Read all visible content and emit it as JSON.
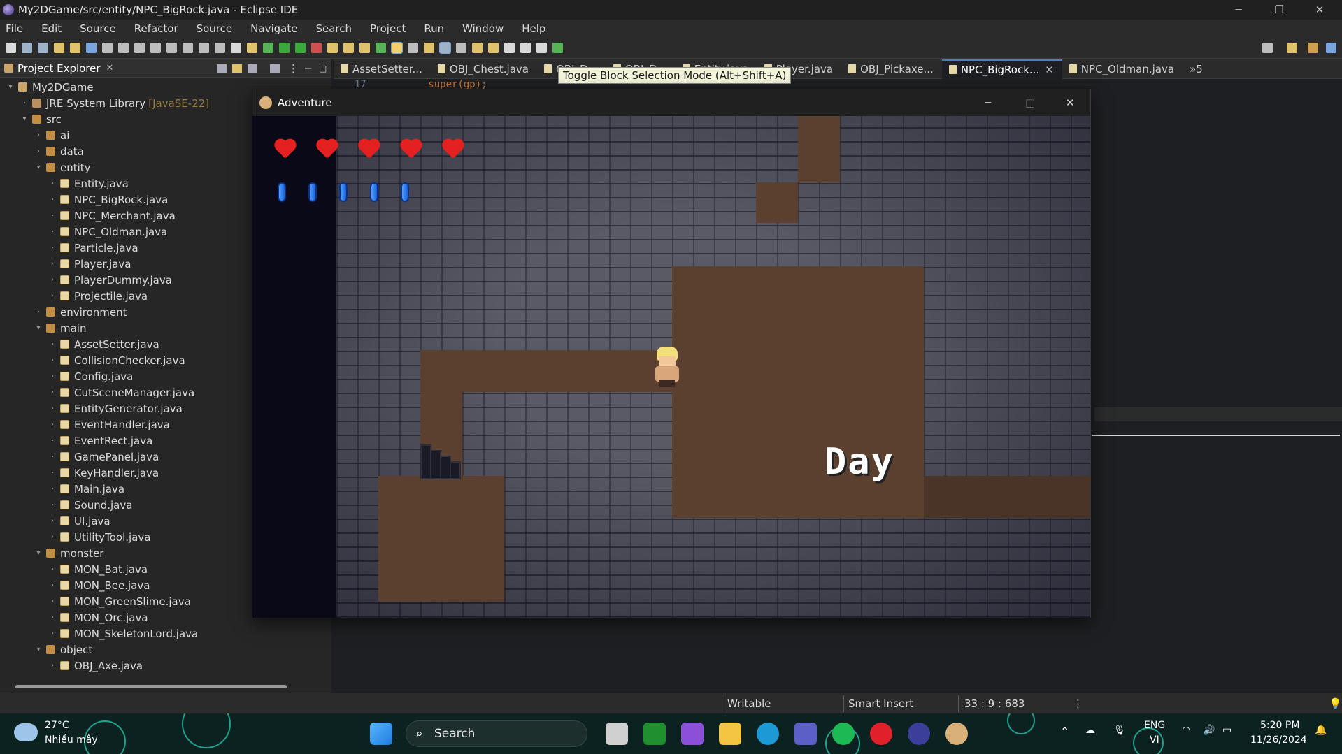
{
  "window": {
    "title": "My2DGame/src/entity/NPC_BigRock.java - Eclipse IDE"
  },
  "menu": [
    "File",
    "Edit",
    "Source",
    "Refactor",
    "Source",
    "Navigate",
    "Search",
    "Project",
    "Run",
    "Window",
    "Help"
  ],
  "sidebar": {
    "tab_label": "Project Explorer",
    "tree": [
      {
        "label": "My2DGame",
        "icon": "project-icon",
        "depth": 0,
        "expanded": true
      },
      {
        "label": "JRE System Library",
        "suffix": "[JavaSE-22]",
        "icon": "library-icon",
        "depth": 1,
        "expanded": false
      },
      {
        "label": "src",
        "icon": "package-folder-icon",
        "depth": 1,
        "expanded": true
      },
      {
        "label": "ai",
        "icon": "package-icon",
        "depth": 2,
        "expanded": false
      },
      {
        "label": "data",
        "icon": "package-icon",
        "depth": 2,
        "expanded": false
      },
      {
        "label": "entity",
        "icon": "package-icon",
        "depth": 2,
        "expanded": true
      },
      {
        "label": "Entity.java",
        "icon": "java-file-icon",
        "depth": 3
      },
      {
        "label": "NPC_BigRock.java",
        "icon": "java-file-icon",
        "depth": 3
      },
      {
        "label": "NPC_Merchant.java",
        "icon": "java-file-icon",
        "depth": 3
      },
      {
        "label": "NPC_Oldman.java",
        "icon": "java-file-icon",
        "depth": 3
      },
      {
        "label": "Particle.java",
        "icon": "java-file-icon",
        "depth": 3
      },
      {
        "label": "Player.java",
        "icon": "java-file-icon",
        "depth": 3
      },
      {
        "label": "PlayerDummy.java",
        "icon": "java-file-icon",
        "depth": 3
      },
      {
        "label": "Projectile.java",
        "icon": "java-file-icon",
        "depth": 3
      },
      {
        "label": "environment",
        "icon": "package-icon",
        "depth": 2,
        "expanded": false
      },
      {
        "label": "main",
        "icon": "package-icon",
        "depth": 2,
        "expanded": true
      },
      {
        "label": "AssetSetter.java",
        "icon": "java-file-icon",
        "depth": 3
      },
      {
        "label": "CollisionChecker.java",
        "icon": "java-file-icon",
        "depth": 3
      },
      {
        "label": "Config.java",
        "icon": "java-file-icon",
        "depth": 3
      },
      {
        "label": "CutSceneManager.java",
        "icon": "java-file-icon",
        "depth": 3
      },
      {
        "label": "EntityGenerator.java",
        "icon": "java-file-icon",
        "depth": 3
      },
      {
        "label": "EventHandler.java",
        "icon": "java-file-icon",
        "depth": 3
      },
      {
        "label": "EventRect.java",
        "icon": "java-file-icon",
        "depth": 3
      },
      {
        "label": "GamePanel.java",
        "icon": "java-file-icon",
        "depth": 3
      },
      {
        "label": "KeyHandler.java",
        "icon": "java-file-icon",
        "depth": 3
      },
      {
        "label": "Main.java",
        "icon": "java-file-icon",
        "depth": 3
      },
      {
        "label": "Sound.java",
        "icon": "java-file-icon",
        "depth": 3
      },
      {
        "label": "UI.java",
        "icon": "java-file-icon",
        "depth": 3
      },
      {
        "label": "UtilityTool.java",
        "icon": "java-file-icon",
        "depth": 3
      },
      {
        "label": "monster",
        "icon": "package-icon",
        "depth": 2,
        "expanded": true
      },
      {
        "label": "MON_Bat.java",
        "icon": "java-file-icon",
        "depth": 3
      },
      {
        "label": "MON_Bee.java",
        "icon": "java-file-icon",
        "depth": 3
      },
      {
        "label": "MON_GreenSlime.java",
        "icon": "java-file-icon",
        "depth": 3
      },
      {
        "label": "MON_Orc.java",
        "icon": "java-file-icon",
        "depth": 3
      },
      {
        "label": "MON_SkeletonLord.java",
        "icon": "java-file-icon",
        "depth": 3
      },
      {
        "label": "object",
        "icon": "package-icon",
        "depth": 2,
        "expanded": true
      },
      {
        "label": "OBJ_Axe.java",
        "icon": "java-file-icon",
        "depth": 3
      }
    ]
  },
  "editor": {
    "tabs": [
      {
        "label": "AssetSetter...",
        "active": false
      },
      {
        "label": "OBJ_Chest.java",
        "active": false
      },
      {
        "label": "OBJ_D...",
        "active": false
      },
      {
        "label": "OBJ_D...",
        "active": false
      },
      {
        "label": "Entity.java",
        "active": false
      },
      {
        "label": "Player.java",
        "active": false
      },
      {
        "label": "OBJ_Pickaxe...",
        "active": false
      },
      {
        "label": "NPC_BigRock...",
        "active": true
      },
      {
        "label": "NPC_Oldman.java",
        "active": false
      }
    ],
    "overflow_label": "»5",
    "code_line_number": "17",
    "code_line_text": "super(gp);",
    "tooltip": "Toggle Block Selection Mode (Alt+Shift+A)"
  },
  "status": {
    "writable": "Writable",
    "insert_mode": "Smart Insert",
    "position": "33 : 9 : 683"
  },
  "game": {
    "title": "Adventure",
    "hearts": 5,
    "mana_crystals": 5,
    "time_label": "Day"
  },
  "taskbar": {
    "weather_temp": "27°C",
    "weather_desc": "Nhiều mây",
    "search_label": "Search",
    "lang_top": "ENG",
    "lang_bottom": "VI",
    "time": "5:20 PM",
    "date": "11/26/2024"
  },
  "colors": {
    "accent": "#4e7fc4",
    "floor": "#5b4030",
    "wall": "#5a5a66",
    "heart": "#e52020",
    "mana": "#2f80ff"
  }
}
